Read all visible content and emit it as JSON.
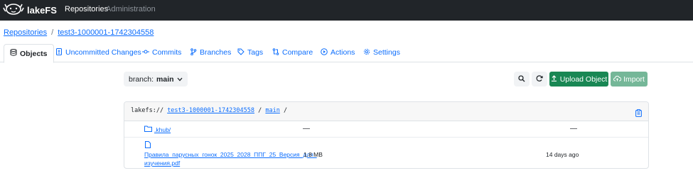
{
  "nav": {
    "brand": "lakeFS",
    "links": [
      "Repositories",
      "Administration"
    ]
  },
  "breadcrumb": {
    "root": "Repositories",
    "separator": "/",
    "repo": "test3-1000001-1742304558"
  },
  "tabs": [
    {
      "label": "Objects",
      "icon": "database-icon"
    },
    {
      "label": "Uncommitted Changes",
      "icon": "file-diff-icon"
    },
    {
      "label": "Commits",
      "icon": "commit-icon"
    },
    {
      "label": "Branches",
      "icon": "branch-icon"
    },
    {
      "label": "Tags",
      "icon": "tag-icon"
    },
    {
      "label": "Compare",
      "icon": "compare-icon"
    },
    {
      "label": "Actions",
      "icon": "play-icon"
    },
    {
      "label": "Settings",
      "icon": "gear-icon"
    }
  ],
  "toolbar": {
    "branch_prefix": "branch:",
    "branch_name": "main",
    "upload_label": "Upload Object",
    "import_label": "Import"
  },
  "path": {
    "scheme": "lakefs://",
    "repo": "test3-1000001-1742304558",
    "sep1": "/",
    "branch": "main",
    "sep2": "/"
  },
  "objects": [
    {
      "name": ".khub/",
      "size": "—",
      "modified": "—",
      "type": "folder"
    },
    {
      "name_line1": "Правила_парусных_гонок_2025_2028_ППГ_25_Версия_для_",
      "name_line2": "изучения.pdf",
      "size": "1.8 MB",
      "modified": "14 days ago",
      "type": "file"
    }
  ],
  "colors": {
    "primary": "#0d6efd",
    "success": "#198754",
    "navbar": "#212529"
  }
}
